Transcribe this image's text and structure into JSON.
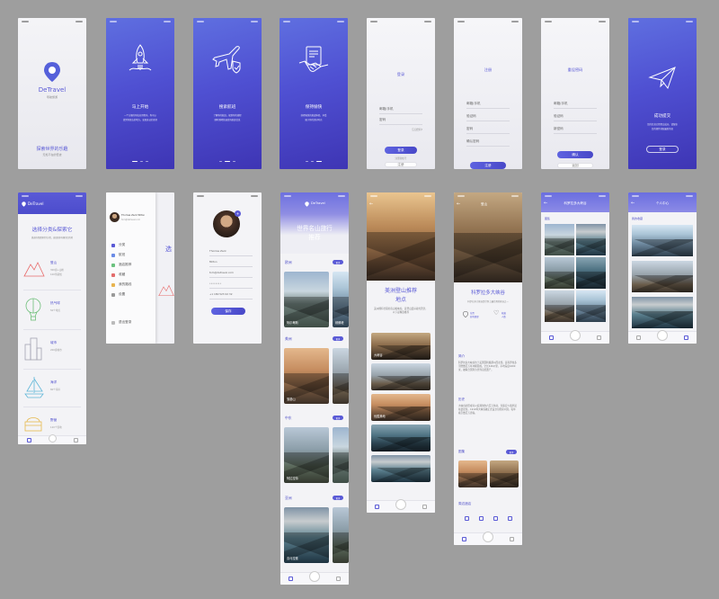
{
  "splash": {
    "logo_text": "DeTravel",
    "logo_sub": "导航旅游",
    "slogan": "探索世界的乐趣",
    "sub_slogan": "无处不在的奇迹"
  },
  "onboard": [
    {
      "title": "马上开始",
      "text1": "一个方便的导航应用程序，你可以",
      "text2": "找到你想去的地方，发现身边的美好"
    },
    {
      "title": "搜索航班",
      "text1": "了解你的航班，规划你的旅程",
      "text2": "随时随地快速查询航班信息"
    },
    {
      "title": "保持愉快",
      "text1": "获得愉快的旅途体验，享受",
      "text2": "属于你的美好时光"
    }
  ],
  "login": {
    "title": "登录",
    "user_label": "邮箱/手机",
    "pwd_label": "密码",
    "forgot": "忘记密码?",
    "login_btn": "登录",
    "register_btn": "注册",
    "register_link": "注册新帐号"
  },
  "register": {
    "title": "注册",
    "f1": "邮箱/手机",
    "f2": "验证码",
    "f3": "密码",
    "f4": "确认密码",
    "btn": "注册"
  },
  "reset": {
    "title": "重设密码",
    "f1": "邮箱/手机",
    "f2": "验证码",
    "f3": "新密码",
    "btn": "确认",
    "btn2": "返回"
  },
  "success": {
    "title": "成功提交",
    "text1": "您的信息已经提交成功，请留意",
    "text2": "您的邮件获取最新消息",
    "btn": "登录"
  },
  "category": {
    "brand": "DeTravel",
    "title": "选择分类&探索它",
    "desc": "挑选你想要探索的分类，发现更多有趣的目的地",
    "items": [
      {
        "label": "登山",
        "sub1": "300座+山峰",
        "sub2": "100条路线"
      },
      {
        "label": "热气球",
        "sub1": "50个地点"
      },
      {
        "label": "城市",
        "sub1": "200座城市"
      },
      {
        "label": "海洋",
        "sub1": "80个海岸"
      },
      {
        "label": "野营",
        "sub1": "120个营地"
      }
    ]
  },
  "drawer": {
    "user_name": "Thomas Zack Milton",
    "user_email": "tom@detravel.com",
    "items": [
      "分类",
      "航班",
      "酒店推荐",
      "收藏",
      "我的路线",
      "设置"
    ],
    "logout": "退出登录",
    "peek_title": "选"
  },
  "profile_edit": {
    "name": "Thomas Zack",
    "user": "Milton",
    "email": "tom@detravel.com",
    "pwd": "••••••••",
    "phone": "+1 180 523 02 32",
    "btn": "保存"
  },
  "world": {
    "brand": "DeTravel",
    "title1": "世界名山旅行",
    "title2": "推荐",
    "more": "更多",
    "sections": [
      {
        "name": "欧洲",
        "card": "阿尔卑斯",
        "card2": "勃朗峰"
      },
      {
        "name": "美洲",
        "card": "落基山"
      },
      {
        "name": "中东",
        "card": "阿拉拉特"
      },
      {
        "name": "亚洲",
        "card": "喜马拉雅"
      }
    ]
  },
  "america": {
    "title1": "美洲登山推荐",
    "title2": "地点",
    "desc": "美洲拥有壮丽的高山和峡谷，是登山爱好者的天堂，以下是精选推荐",
    "list": [
      "大峡谷",
      "",
      "优胜美地",
      "",
      ""
    ]
  },
  "canyon": {
    "top_title": "登山",
    "title": "科罗拉多大峡谷",
    "desc": "科罗拉多大峡谷是世界上最壮观的峡谷之一",
    "stat1_a": "位置",
    "stat1_b": "亚利桑那",
    "stat2_a": "收藏",
    "stat2_b": "人数",
    "sec1": "简介",
    "intro": "科罗拉多大峡谷位于美国亚利桑那州西北部，是科罗拉多河经数百万年冲刷而成，全长446公里，平均深度1600米，被联合国列为世界自然遗产。",
    "sec2": "历史",
    "history": "大峡谷的形成可以追溯到约六百万年前，印第安人很早就在此居住，1919年大峡谷被正式设立为国家公园，每年吸引数百万游客。",
    "sec3": "图集",
    "sec4": "周边酒店",
    "more": "更多"
  },
  "gallery": {
    "title": "科罗拉多大峡谷",
    "section": "图集"
  },
  "center": {
    "title": "个人中心",
    "section": "我的收藏"
  },
  "colors": {
    "accent": "#5a5ad6",
    "grad_top": "#5f6fe0",
    "grad_bottom": "#3e35b4",
    "bg": "#9e9e9e"
  }
}
